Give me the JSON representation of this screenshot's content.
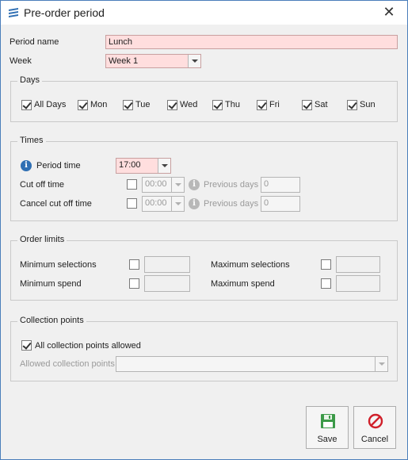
{
  "window": {
    "title": "Pre-order period",
    "icon": "app-logo-icon",
    "close_icon": "close-icon"
  },
  "general": {
    "period_name_label": "Period name",
    "period_name_value": "Lunch",
    "week_label": "Week",
    "week_value": "Week 1"
  },
  "days": {
    "title": "Days",
    "items": [
      {
        "label": "All Days",
        "checked": true
      },
      {
        "label": "Mon",
        "checked": true
      },
      {
        "label": "Tue",
        "checked": true
      },
      {
        "label": "Wed",
        "checked": true
      },
      {
        "label": "Thu",
        "checked": true
      },
      {
        "label": "Fri",
        "checked": true
      },
      {
        "label": "Sat",
        "checked": true
      },
      {
        "label": "Sun",
        "checked": true
      }
    ]
  },
  "times": {
    "title": "Times",
    "period_time_label": "Period time",
    "period_time_value": "17:00",
    "cut_off_label": "Cut off time",
    "cut_off_value": "00:00",
    "cut_off_prev_label": "Previous days",
    "cut_off_prev_value": "0",
    "cancel_cut_off_label": "Cancel cut off time",
    "cancel_cut_off_value": "00:00",
    "cancel_prev_label": "Previous days",
    "cancel_prev_value": "0"
  },
  "order_limits": {
    "title": "Order limits",
    "min_selections_label": "Minimum selections",
    "min_spend_label": "Minimum spend",
    "max_selections_label": "Maximum selections",
    "max_spend_label": "Maximum spend"
  },
  "collection": {
    "title": "Collection points",
    "all_allowed_label": "All collection points allowed",
    "all_allowed_checked": true,
    "allowed_points_label": "Allowed collection points"
  },
  "buttons": {
    "save_label": "Save",
    "cancel_label": "Cancel"
  },
  "colors": {
    "required_field_bg": "#ffdede",
    "accent": "#2f6fb3",
    "save_icon": "#2e8b3a",
    "cancel_icon": "#d0202a"
  }
}
